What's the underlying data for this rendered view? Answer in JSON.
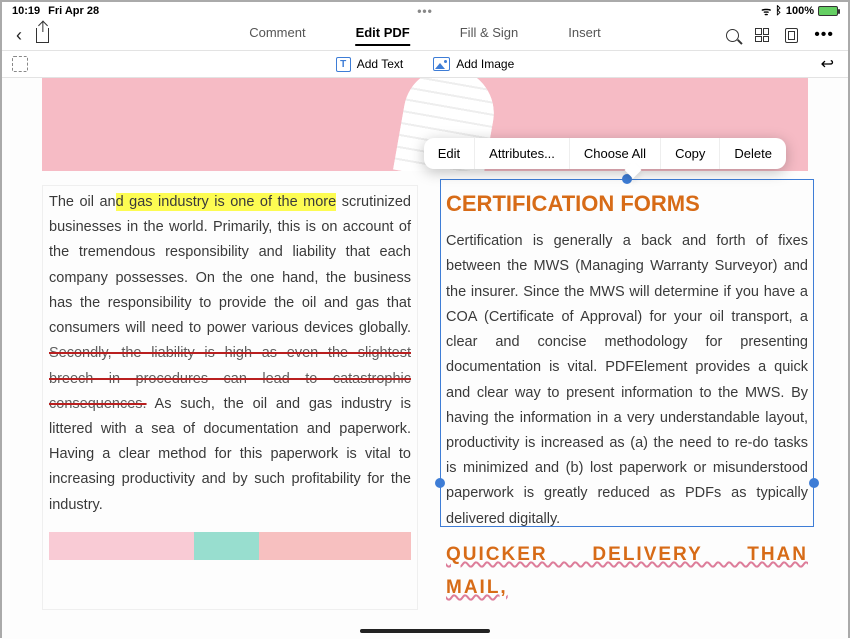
{
  "status": {
    "time": "10:19",
    "date": "Fri Apr 28",
    "battery": "100%"
  },
  "toolbar": {
    "tabs": [
      "Comment",
      "Edit PDF",
      "Fill & Sign",
      "Insert"
    ],
    "active_tab": "Edit PDF",
    "add_text": "Add Text",
    "add_image": "Add Image"
  },
  "popup": {
    "edit": "Edit",
    "attributes": "Attributes...",
    "choose_all": "Choose All",
    "copy": "Copy",
    "delete": "Delete"
  },
  "left": {
    "p1a": "The oil an",
    "p1_hl": "d gas industry is one of the more",
    "p1b": " scrutinized businesses in the world. Primarily, this is on account of the tremendous responsibility and liability that each company possesses. On the one hand, the business has the responsibility to provide the oil and gas that consumers will need to power various devices globally. ",
    "p1_strike": "Secondly, the liability is high as even the slightest breech in procedures can lead to catastrophic consequences.",
    "p1c": " As such, the oil and gas industry is littered with a sea of documentation and paperwork. Having a clear method for this paperwork is vital to increasing productivity and by such profitability for the industry."
  },
  "right": {
    "h1": "CERTIFICATION FORMS",
    "p1": "Certification is generally a back and forth of fixes between the MWS (Managing Warranty Surveyor) and the insurer. Since the MWS will determine if you have a COA (Certificate of Approval) for your oil transport, a clear and concise methodology for presenting documentation is vital. PDFElement provides a quick and clear way to present information to the MWS. By having the information in a very understandable layout, productivity is increased as (a) the need to re-do tasks is minimized and (b) lost paperwork or misunderstood paperwork is greatly reduced as PDFs as typically delivered digitally.",
    "h2": "QUICKER DELIVERY THAN MAIL,"
  }
}
